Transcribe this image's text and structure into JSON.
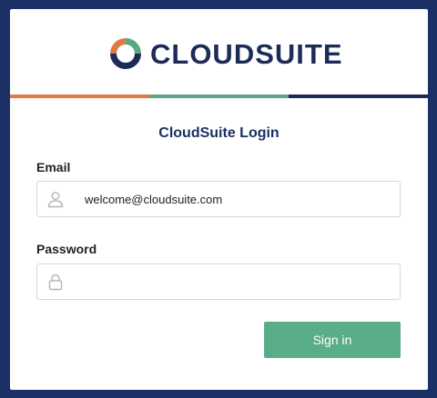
{
  "brand": {
    "name": "CLOUDSUITE"
  },
  "colors": {
    "orange": "#e07a45",
    "green": "#5aa883",
    "navy": "#1c2b57",
    "button": "#5aad89"
  },
  "login": {
    "title": "CloudSuite Login",
    "email_label": "Email",
    "email_value": "welcome@cloudsuite.com",
    "password_label": "Password",
    "password_value": "",
    "signin_label": "Sign in"
  },
  "icons": {
    "email": "user-icon",
    "password": "lock-icon"
  }
}
